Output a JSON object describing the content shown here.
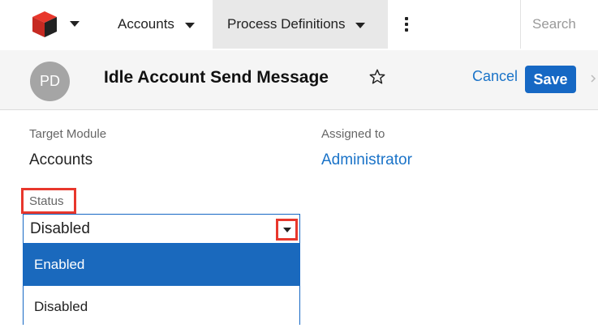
{
  "nav": {
    "logo_icon": "sugar-cube-logo-icon",
    "accounts_label": "Accounts",
    "process_label": "Process Definitions",
    "search_placeholder": "Search"
  },
  "record": {
    "avatar_initials": "PD",
    "title": "Idle Account Send Message",
    "cancel_label": "Cancel",
    "save_label": "Save"
  },
  "fields": {
    "target_module_label": "Target Module",
    "target_module_value": "Accounts",
    "assigned_to_label": "Assigned to",
    "assigned_to_value": "Administrator",
    "status_label": "Status",
    "status_value": "Disabled",
    "status_options": [
      "Enabled",
      "Disabled"
    ]
  },
  "colors": {
    "accent": "#1668c4",
    "highlight_box": "#e8372c",
    "selected_option": "#1a69bd"
  }
}
